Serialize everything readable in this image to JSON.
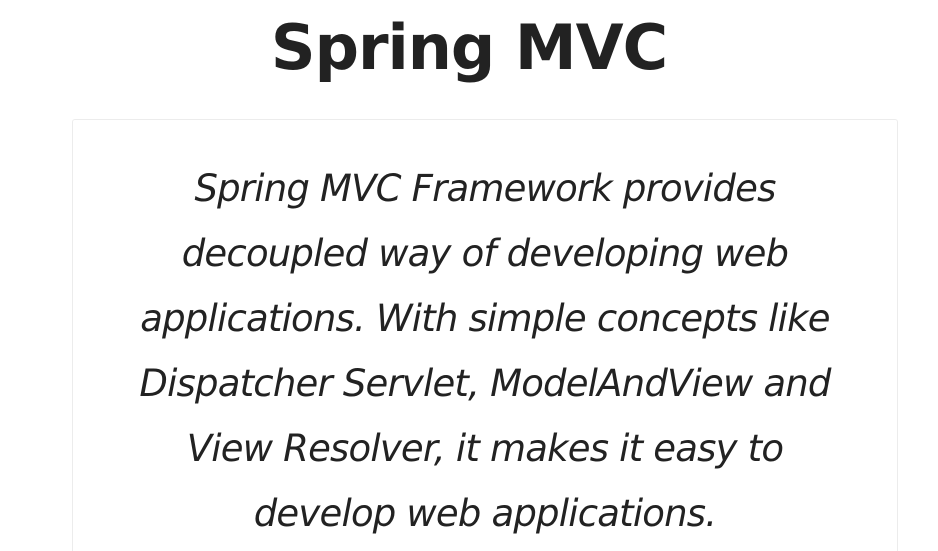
{
  "page": {
    "title": "Spring MVC"
  },
  "card": {
    "lines": [
      "Spring MVC Framework provides",
      "decoupled way of developing web",
      "applications. With simple concepts like",
      "Dispatcher Servlet, ModelAndView and",
      "View Resolver, it makes it easy to",
      "develop web applications."
    ]
  }
}
